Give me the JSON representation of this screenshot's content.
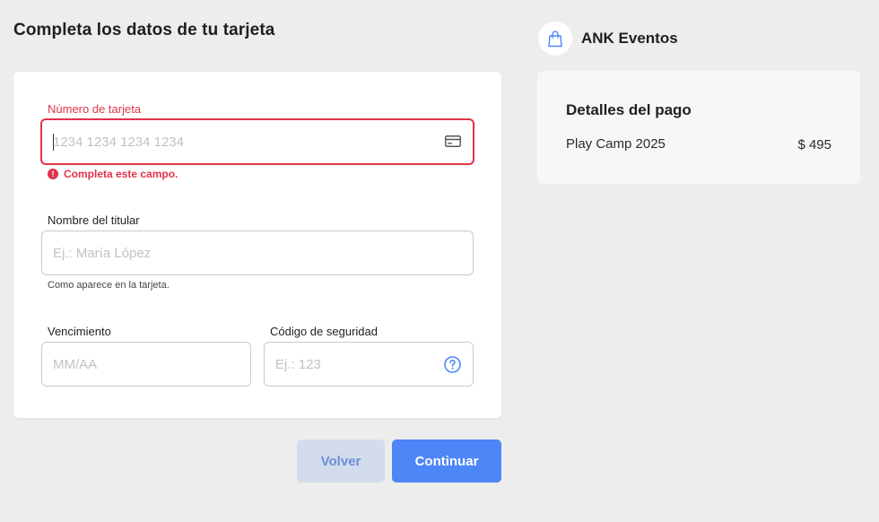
{
  "page": {
    "title": "Completa los datos de tu tarjeta"
  },
  "form": {
    "card_number": {
      "label": "Número de tarjeta",
      "placeholder": "1234 1234 1234 1234",
      "value": "",
      "error": "Completa este campo.",
      "icon": "credit-card-icon"
    },
    "holder_name": {
      "label": "Nombre del titular",
      "placeholder": "Ej.: María López",
      "value": "",
      "hint": "Como aparece en la tarjeta."
    },
    "expiry": {
      "label": "Vencimiento",
      "placeholder": "MM/AA",
      "value": ""
    },
    "security_code": {
      "label": "Código de seguridad",
      "placeholder": "Ej.: 123",
      "value": "",
      "icon": "help-icon"
    }
  },
  "actions": {
    "back_label": "Volver",
    "continue_label": "Continuar"
  },
  "merchant": {
    "name": "ANK Eventos",
    "icon": "shopping-bag-icon"
  },
  "payment_details": {
    "title": "Detalles del pago",
    "item_name": "Play Camp 2025",
    "item_price": "$ 495"
  },
  "colors": {
    "background": "#ededed",
    "error": "#e0334a",
    "primary": "#4d86f7",
    "secondary_button": "#d3dcec",
    "secondary_button_text": "#6b8fd8"
  }
}
